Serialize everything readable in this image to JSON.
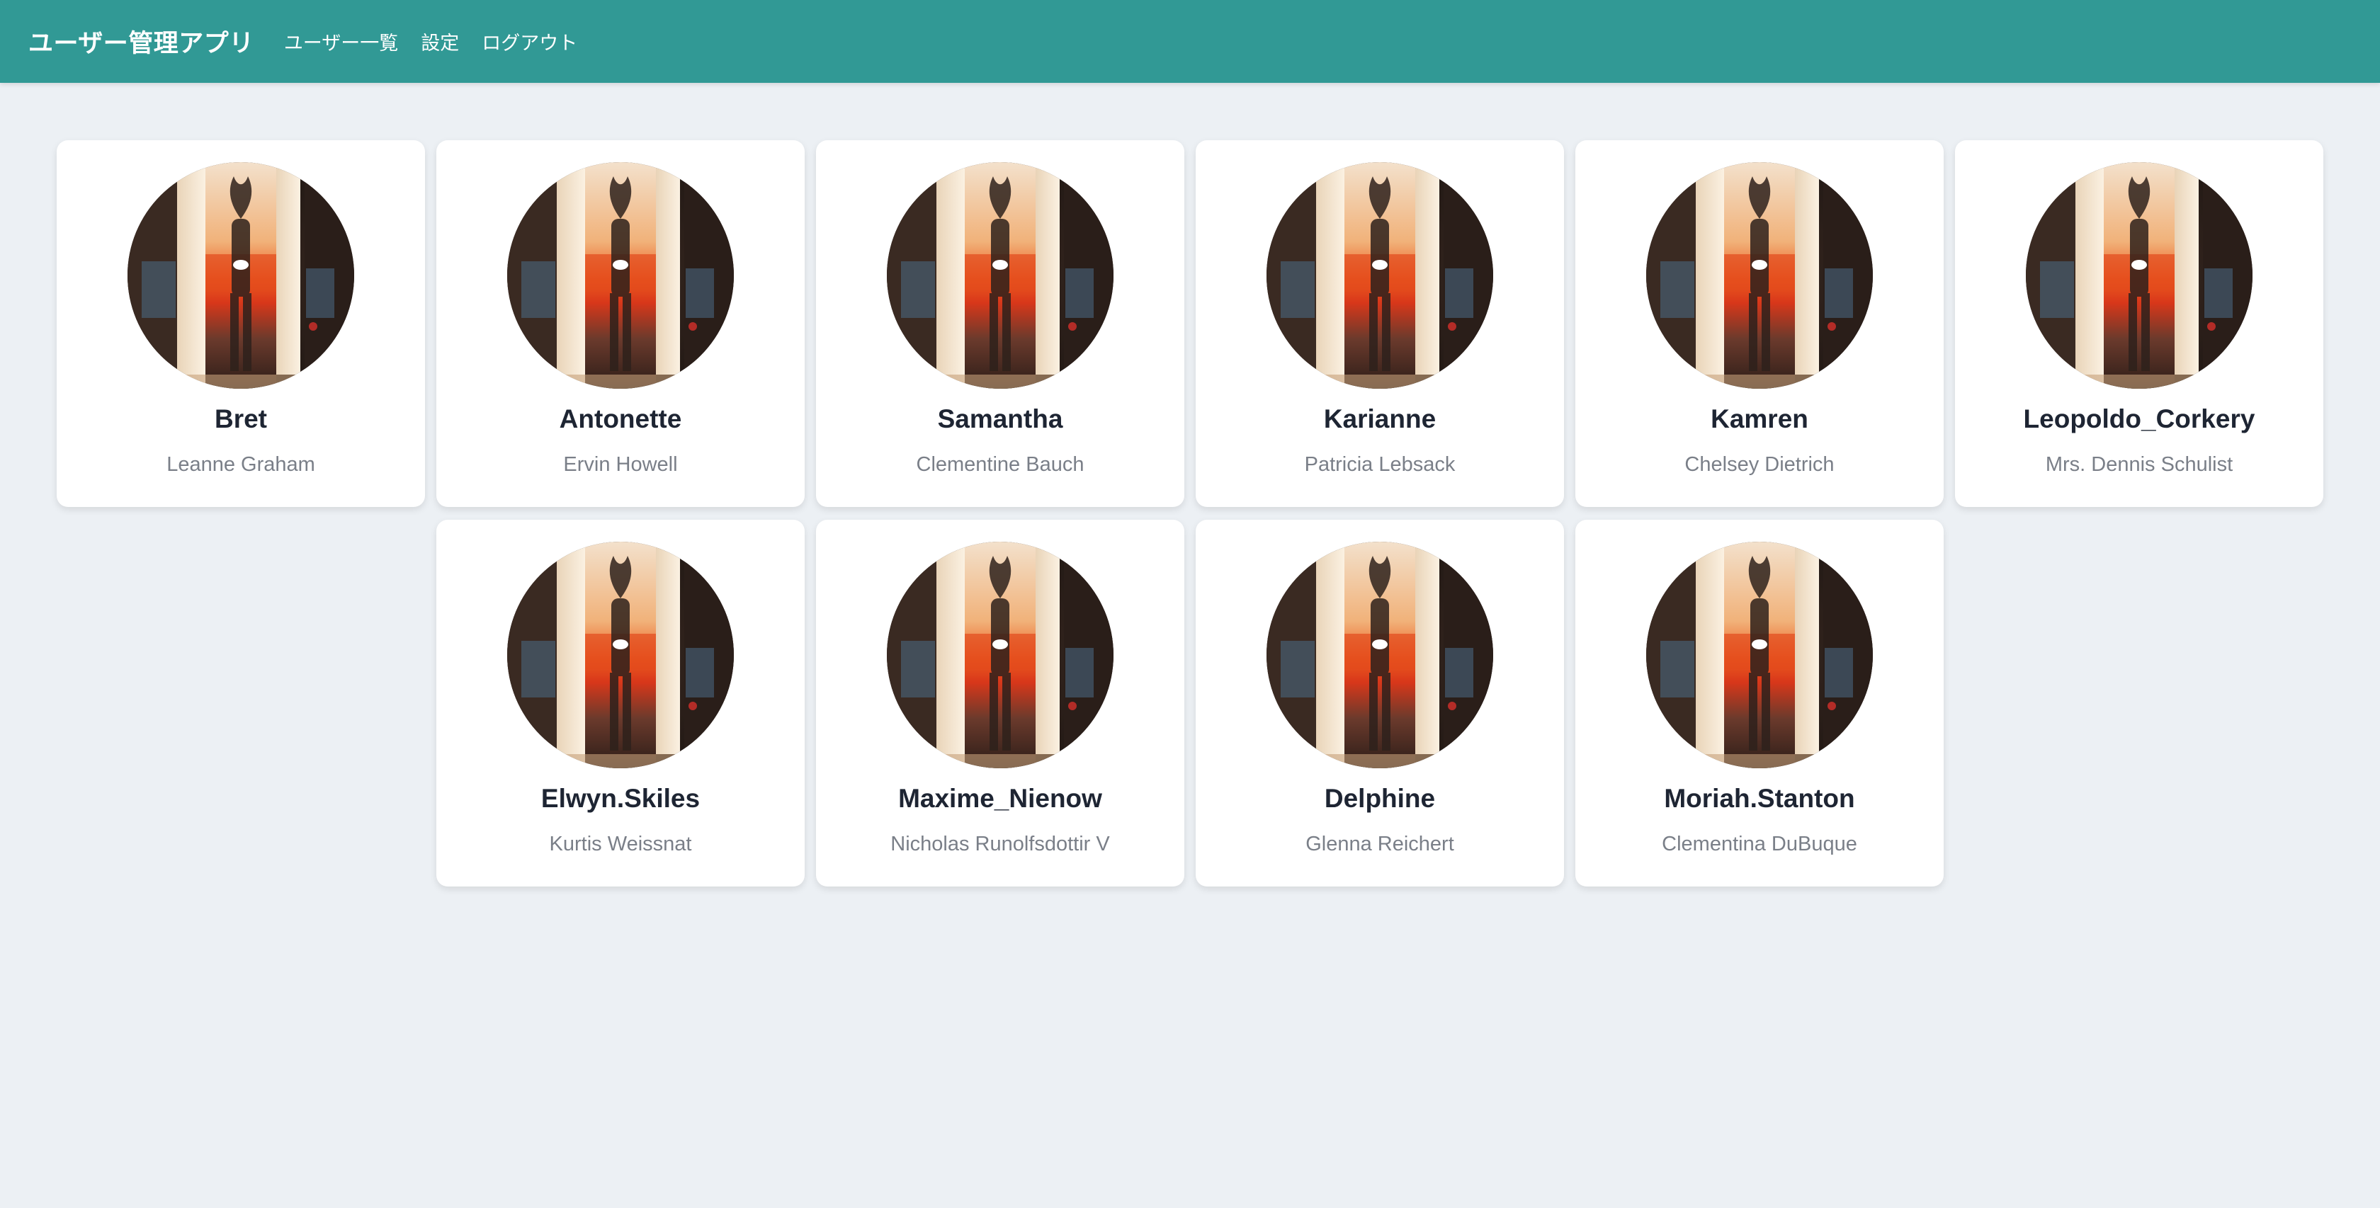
{
  "header": {
    "title": "ユーザー管理アプリ",
    "nav": [
      {
        "label": "ユーザー一覧"
      },
      {
        "label": "設定"
      },
      {
        "label": "ログアウト"
      }
    ],
    "accent_color": "#319995"
  },
  "users": [
    {
      "username": "Bret",
      "name": "Leanne Graham"
    },
    {
      "username": "Antonette",
      "name": "Ervin Howell"
    },
    {
      "username": "Samantha",
      "name": "Clementine Bauch"
    },
    {
      "username": "Karianne",
      "name": "Patricia Lebsack"
    },
    {
      "username": "Kamren",
      "name": "Chelsey Dietrich"
    },
    {
      "username": "Leopoldo_Corkery",
      "name": "Mrs. Dennis Schulist"
    },
    {
      "username": "Elwyn.Skiles",
      "name": "Kurtis Weissnat"
    },
    {
      "username": "Maxime_Nienow",
      "name": "Nicholas Runolfsdottir V"
    },
    {
      "username": "Delphine",
      "name": "Glenna Reichert"
    },
    {
      "username": "Moriah.Stanton",
      "name": "Clementina DuBuque"
    }
  ],
  "avatar_icon": "avatar-photo-silhouette"
}
